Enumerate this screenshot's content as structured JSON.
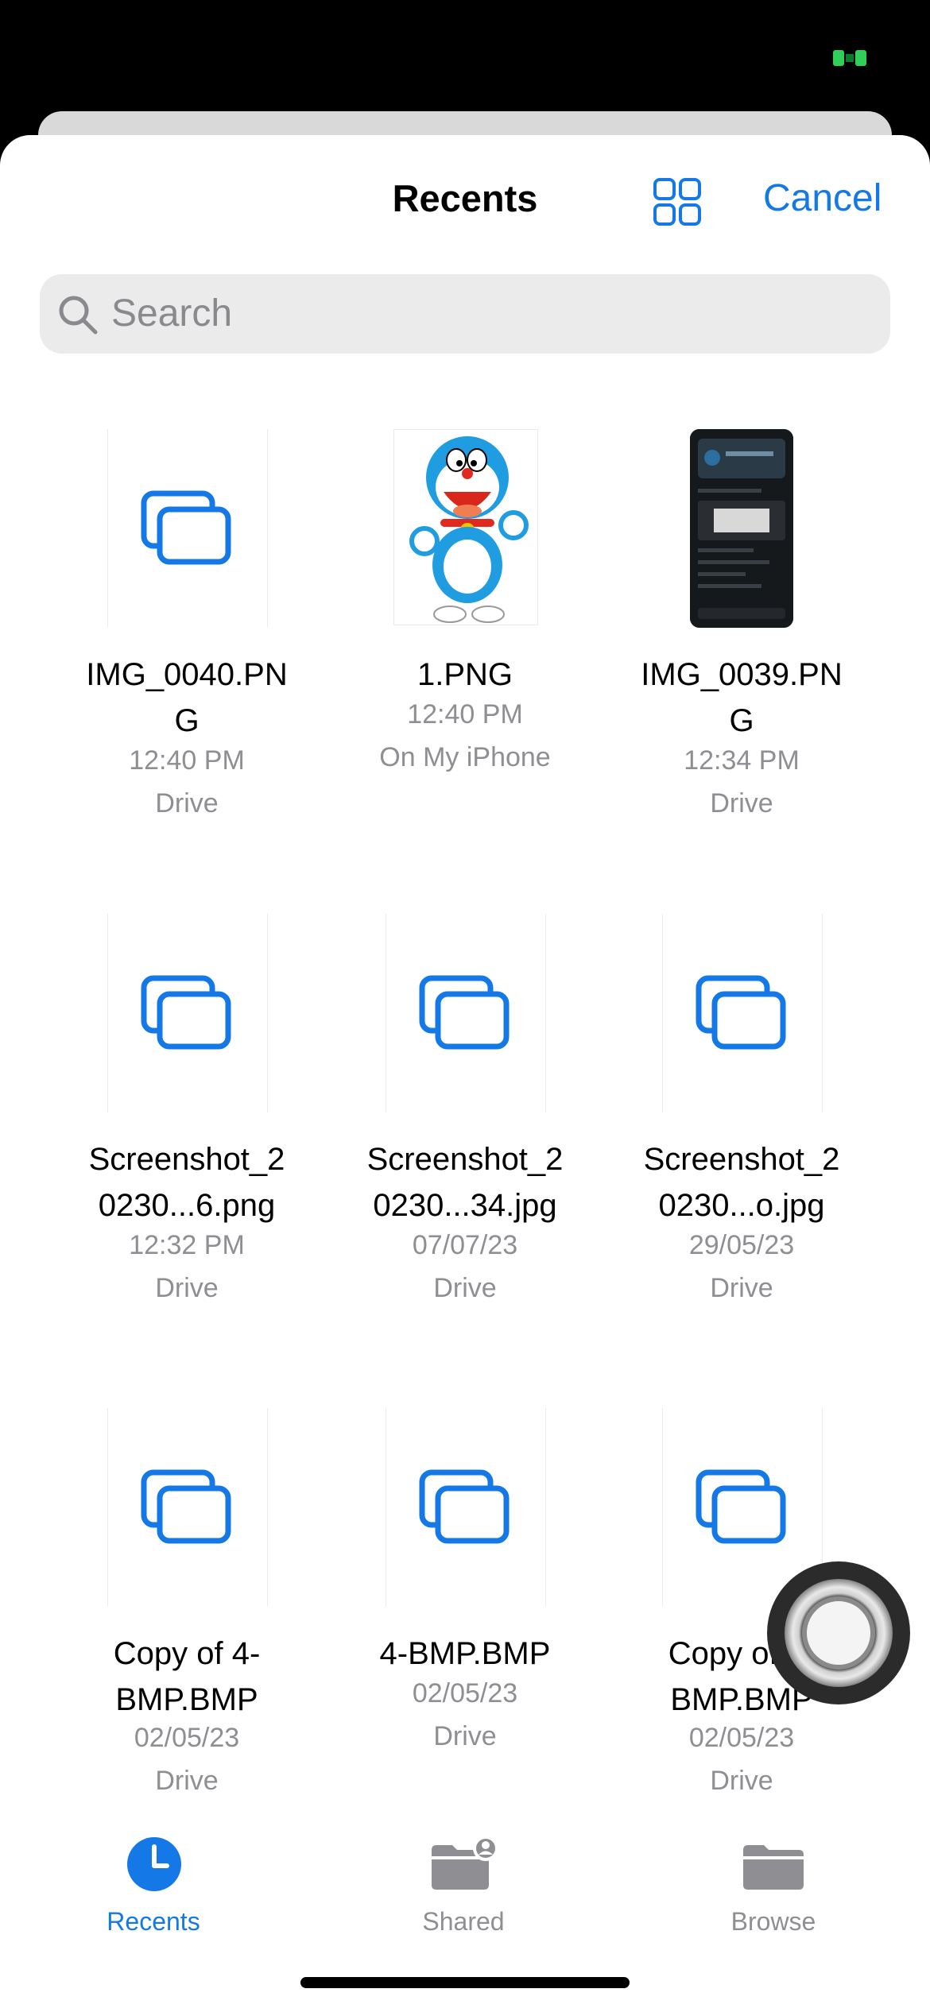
{
  "header": {
    "title": "Recents",
    "cancel_label": "Cancel"
  },
  "search": {
    "placeholder": "Search"
  },
  "files": [
    {
      "name": "IMG_0040.PN\nG",
      "time": "12:40 PM",
      "location": "Drive",
      "thumbnail": "generic-file-icon"
    },
    {
      "name": "1.PNG",
      "time": "12:40 PM",
      "location": "On My iPhone",
      "thumbnail": "doraemon-image"
    },
    {
      "name": "IMG_0039.PN\nG",
      "time": "12:34 PM",
      "location": "Drive",
      "thumbnail": "phone-screenshot"
    },
    {
      "name": "Screenshot_2\n0230...6.png",
      "time": "12:32 PM",
      "location": "Drive",
      "thumbnail": "generic-file-icon"
    },
    {
      "name": "Screenshot_2\n0230...34.jpg",
      "time": "07/07/23",
      "location": "Drive",
      "thumbnail": "generic-file-icon"
    },
    {
      "name": "Screenshot_2\n0230...o.jpg",
      "time": "29/05/23",
      "location": "Drive",
      "thumbnail": "generic-file-icon"
    },
    {
      "name": "Copy of 4-\nBMP.BMP",
      "time": "02/05/23",
      "location": "Drive",
      "thumbnail": "generic-file-icon"
    },
    {
      "name": "4-BMP.BMP",
      "time": "02/05/23",
      "location": "Drive",
      "thumbnail": "generic-file-icon"
    },
    {
      "name": "Copy of 4-\nBMP.BMP",
      "time": "02/05/23",
      "location": "Drive",
      "thumbnail": "generic-file-icon"
    }
  ],
  "tabs": [
    {
      "label": "Recents",
      "icon": "clock-icon",
      "active": true
    },
    {
      "label": "Shared",
      "icon": "shared-folder-icon",
      "active": false
    },
    {
      "label": "Browse",
      "icon": "folder-icon",
      "active": false
    }
  ],
  "colors": {
    "accent": "#1479e6",
    "secondary_text": "#8e8e93",
    "search_bg": "#ebebec",
    "inactive_tab": "#8e8e93"
  }
}
